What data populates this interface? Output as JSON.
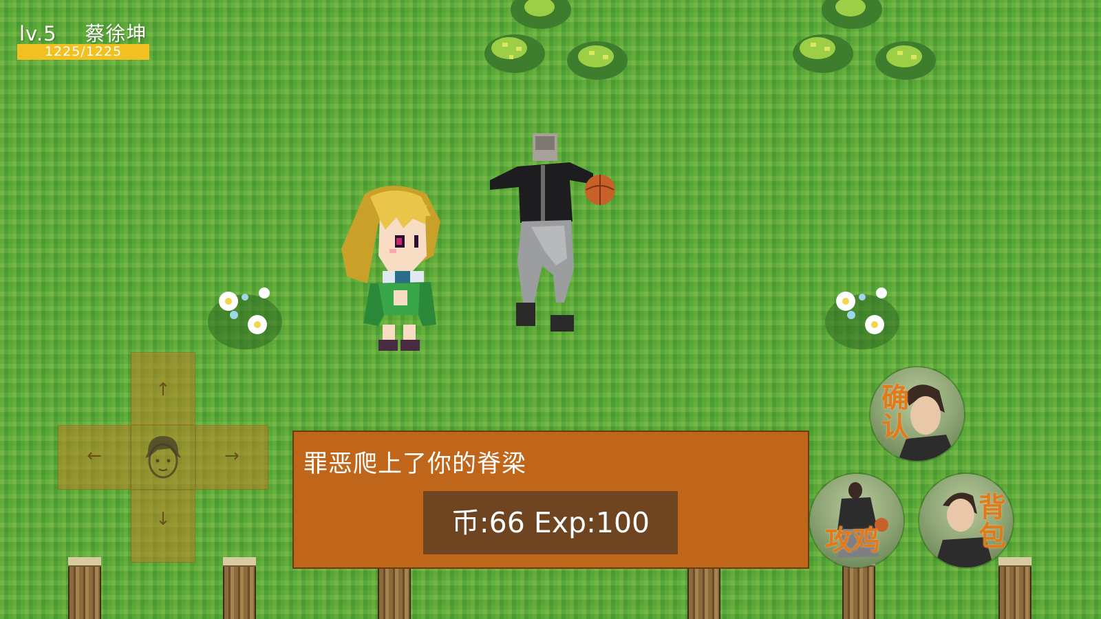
{
  "hud": {
    "level": "lv.5",
    "player_name": "蔡徐坤",
    "hp_text": "1225/1225",
    "hp_current": 1225,
    "hp_max": 1225
  },
  "dialog": {
    "message": "罪恶爬上了你的脊梁",
    "reward": "币:66 Exp:100"
  },
  "buttons": {
    "confirm": "确认",
    "attack": "攻鸡",
    "bag": "背包"
  },
  "dpad": {
    "up": "↑",
    "down": "↓",
    "left": "←",
    "right": "→"
  },
  "colors": {
    "grass": "#58a93a",
    "hp_fill": "#f2c021",
    "dialog_bg": "#c0661a",
    "reward_bg": "#6f4521",
    "button_label": "#e07a1a"
  },
  "icons": {
    "dpad_center": "face-icon",
    "basketball": "basketball-icon"
  }
}
